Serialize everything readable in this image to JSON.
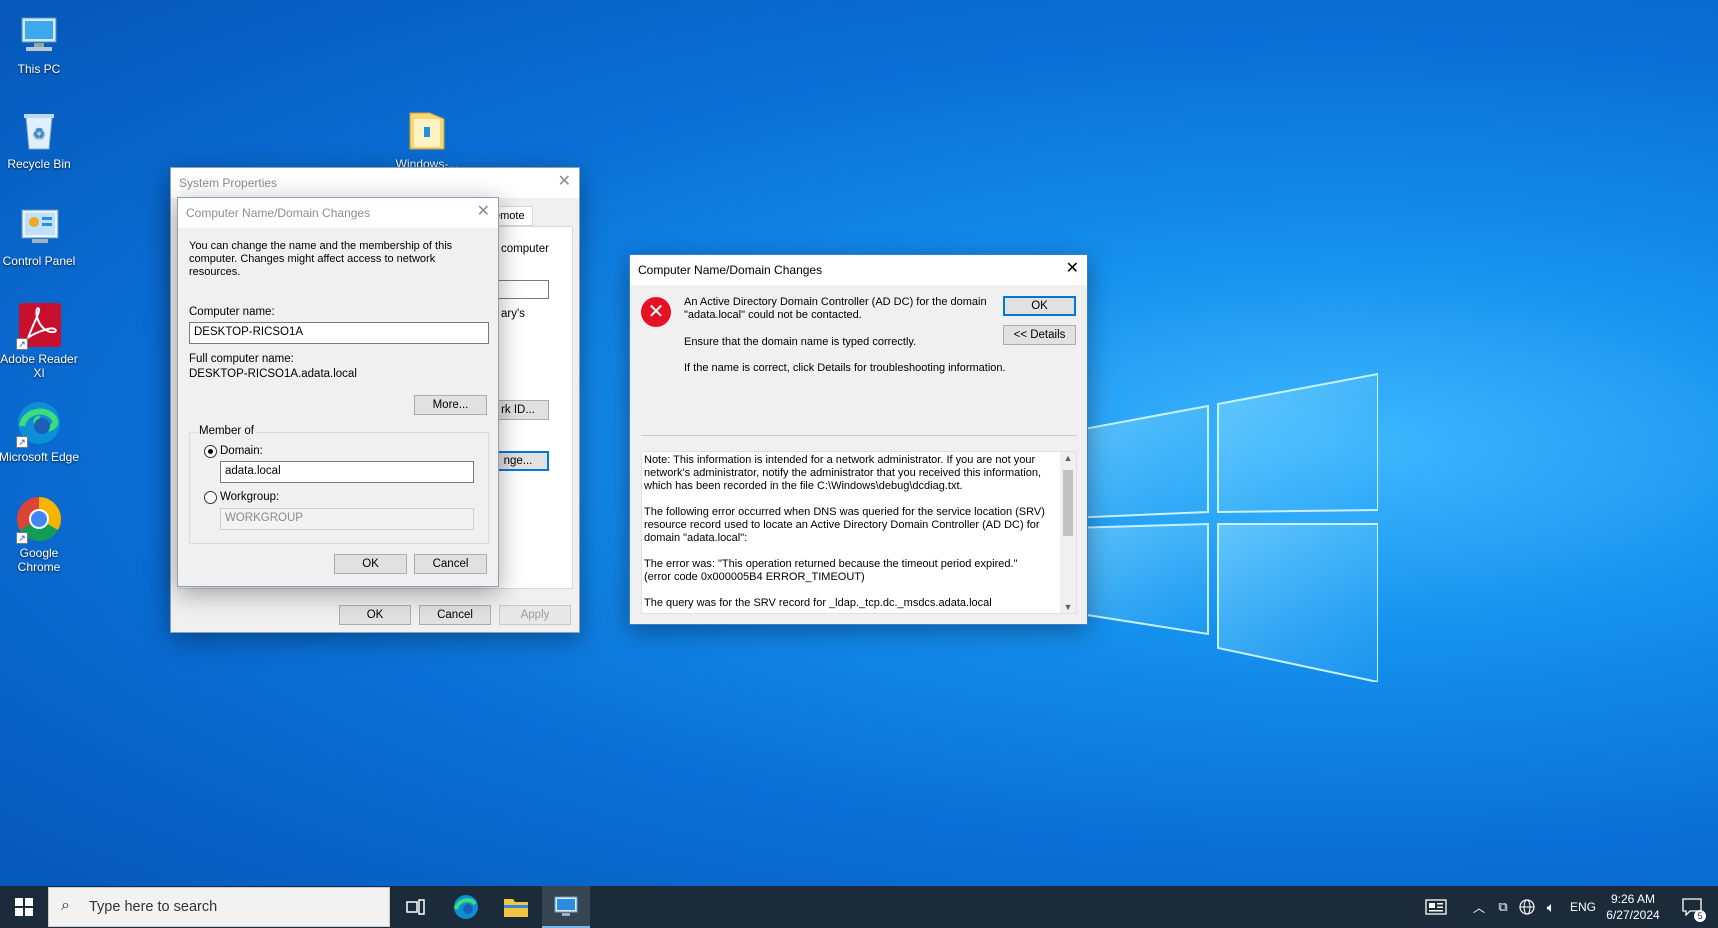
{
  "desktop": {
    "icons": [
      {
        "label": "This PC"
      },
      {
        "label": "Recycle Bin"
      },
      {
        "label": "Control Panel"
      },
      {
        "label": "Adobe Reader XI"
      },
      {
        "label": "Microsoft Edge"
      },
      {
        "label": "Google Chrome"
      },
      {
        "label": "Windows-..."
      }
    ]
  },
  "system_properties": {
    "title": "System Properties",
    "partial_tab": "emote",
    "partial_text1": "computer",
    "partial_text2": "ary's",
    "partial_btn_network_id": "rk ID...",
    "partial_btn_change": "nge...",
    "ok_label": "OK",
    "cancel_label": "Cancel",
    "apply_label": "Apply"
  },
  "name_change_dialog": {
    "title": "Computer Name/Domain Changes",
    "intro": "You can change the name and the membership of this computer. Changes might affect access to network resources.",
    "computer_name_label": "Computer name:",
    "computer_name_value": "DESKTOP-RICSO1A",
    "full_name_label": "Full computer name:",
    "full_name_value": "DESKTOP-RICSO1A.adata.local",
    "more_label": "More...",
    "member_of_label": "Member of",
    "domain_label": "Domain:",
    "domain_value": "adata.local",
    "workgroup_label": "Workgroup:",
    "workgroup_value": "WORKGROUP",
    "ok_label": "OK",
    "cancel_label": "Cancel"
  },
  "error_dialog": {
    "title": "Computer Name/Domain Changes",
    "message1": "An Active Directory Domain Controller (AD DC) for the domain \"adata.local\" could not be contacted.",
    "message2": "Ensure that the domain name is typed correctly.",
    "message3": "If the name is correct, click Details for troubleshooting information.",
    "ok_label": "OK",
    "details_label": "<< Details",
    "details_p1": "Note: This information is intended for a network administrator.  If you are not your network's administrator, notify the administrator that you received this information, which has been recorded in the file C:\\Windows\\debug\\dcdiag.txt.",
    "details_p2": "The following error occurred when DNS was queried for the service location (SRV) resource record used to locate an Active Directory Domain Controller (AD DC) for domain \"adata.local\":",
    "details_p3a": "The error was: \"This operation returned because the timeout period expired.\"",
    "details_p3b": "(error code 0x000005B4 ERROR_TIMEOUT)",
    "details_p4": "The query was for the SRV record for _ldap._tcp.dc._msdcs.adata.local"
  },
  "taskbar": {
    "search_placeholder": "Type here to search",
    "language": "ENG",
    "time": "9:26 AM",
    "date": "6/27/2024",
    "notification_count": "5"
  },
  "colors": {
    "accent": "#0078d7",
    "error_red": "#e81123",
    "taskbar": "#1c2b3a"
  }
}
